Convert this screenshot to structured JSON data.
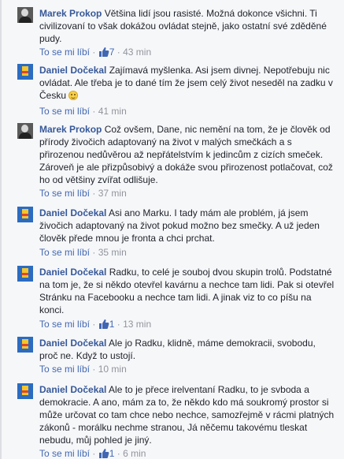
{
  "actions": {
    "like_label": "To se mi líbí",
    "separator": "·"
  },
  "comments": [
    {
      "author": "Marek Prokop",
      "avatar": "marek-photo",
      "text": "Většina lidí jsou rasisté. Možná dokonce všichni. Ti civilizovaní to však dokážou ovládat stejně, jako ostatní své zděděné pudy.",
      "likes": "7",
      "time": "43 min"
    },
    {
      "author": "Daniel Dočekal",
      "avatar": "daniel-flag",
      "text": "Zajímavá myšlenka. Asi jsem divnej. Nepotřebuju nic ovládat. Ale třeba je to dané tím že jsem celý život neseděl na zadku v Česku",
      "emoji": "smile",
      "likes": "",
      "time": "41 min"
    },
    {
      "author": "Marek Prokop",
      "avatar": "marek-photo",
      "text": "Což ovšem, Dane, nic nemění na tom, že je člověk od přírody živočich adaptovaný na život v malých smečkách a s přirozenou nedůvěrou až nepřátelstvím k jedincům z cizích smeček. Zároveň je ale přizpůsobivý a dokáže svou přirozenost potlačovat, což ho od většiny zvířat odlišuje.",
      "likes": "",
      "time": "37 min"
    },
    {
      "author": "Daniel Dočekal",
      "avatar": "daniel-flag",
      "text": "Asi ano Marku. I tady mám ale problém, já jsem živočich adaptovaný na život pokud možno bez smečky. A už jeden člověk přede mnou je fronta a chci prchat.",
      "likes": "",
      "time": "35 min"
    },
    {
      "author": "Daniel Dočekal",
      "avatar": "daniel-flag",
      "text": "Radku, to celé je souboj dvou skupin trolů. Podstatné na tom je, že si někdo otevřel kavárnu a nechce tam lidi. Pak si otevřel Stránku na Facebooku a nechce tam lidi. A jinak viz to co píšu na konci.",
      "likes": "1",
      "time": "13 min"
    },
    {
      "author": "Daniel Dočekal",
      "avatar": "daniel-flag",
      "text": "Ale jo Radku, klidně, máme demokracii, svobodu, proč ne. Když to ustojí.",
      "likes": "",
      "time": "10 min"
    },
    {
      "author": "Daniel Dočekal",
      "avatar": "daniel-flag",
      "text": "Ale to je přece irelventaní Radku, to je svboda a demokracie. A ano, mám za to, že někdo kdo má soukromý prostor si může určovat co tam chce nebo nechce, samozřejmě v rácmi platných zákonů - morálku nechme stranou, Já něčemu takovému tleskat nebudu, můj pohled je jiný.",
      "likes": "1",
      "time": "6 min"
    }
  ],
  "colors": {
    "author": "#365899",
    "link": "#4267b2",
    "meta": "#90949c",
    "background": "#f6f7f9"
  }
}
